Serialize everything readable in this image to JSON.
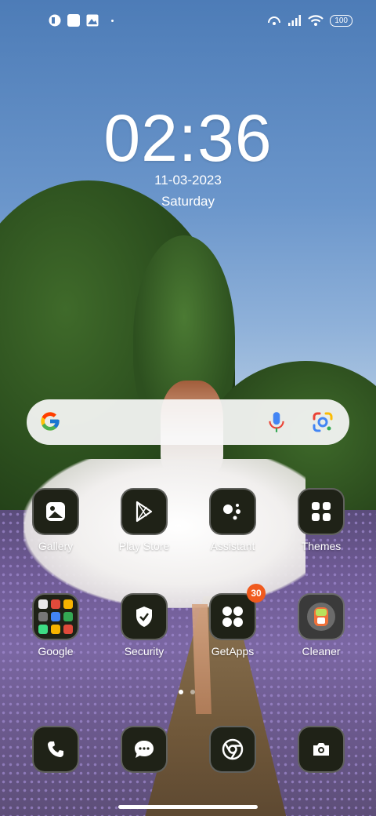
{
  "status_bar": {
    "battery": "100",
    "left_icons": [
      "app-notification-icon",
      "square-notification-icon",
      "gallery-notification-icon",
      "more-dot-icon"
    ],
    "right_icons": [
      "hotspot-icon",
      "signal-icon",
      "wifi-icon",
      "battery-icon"
    ]
  },
  "lockscreen": {
    "time": "02:36",
    "date": "11-03-2023",
    "day": "Saturday"
  },
  "search_bar": {
    "icons": [
      "google-g-icon",
      "microphone-icon",
      "google-lens-icon"
    ]
  },
  "apps_row1": [
    {
      "label": "Gallery",
      "icon": "gallery-icon"
    },
    {
      "label": "Play Store",
      "icon": "play-store-icon"
    },
    {
      "label": "Assistant",
      "icon": "assistant-icon"
    },
    {
      "label": "Themes",
      "icon": "themes-icon"
    }
  ],
  "apps_row2": [
    {
      "label": "Google",
      "icon": "google-folder-icon"
    },
    {
      "label": "Security",
      "icon": "shield-icon"
    },
    {
      "label": "GetApps",
      "icon": "getapps-icon",
      "badge": "30"
    },
    {
      "label": "Cleaner",
      "icon": "cleaner-icon"
    }
  ],
  "dock": [
    {
      "icon": "phone-icon"
    },
    {
      "icon": "messages-icon"
    },
    {
      "icon": "chrome-icon"
    },
    {
      "icon": "camera-icon"
    }
  ],
  "pager": {
    "pages": 2,
    "current": 1
  },
  "colors": {
    "badge": "#f05a1e",
    "icon_bg": "#1f2217"
  }
}
